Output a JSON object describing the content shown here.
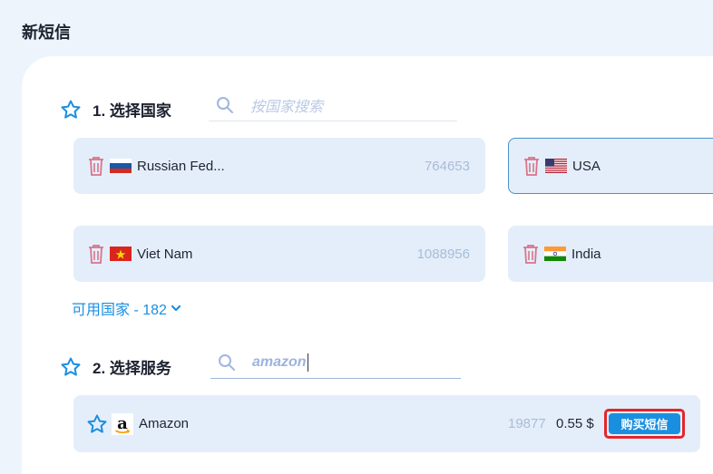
{
  "page": {
    "title": "新短信"
  },
  "country_section": {
    "title": "1. 选择国家",
    "search_placeholder": "按国家搜索",
    "countries": [
      {
        "name": "Russian Fed...",
        "count": "764653",
        "flag": "russia-flag",
        "selected": false
      },
      {
        "name": "USA",
        "count": "",
        "flag": "usa-flag",
        "selected": true
      },
      {
        "name": "Viet Nam",
        "count": "1088956",
        "flag": "vietnam-flag",
        "selected": false
      },
      {
        "name": "India",
        "count": "",
        "flag": "india-flag",
        "selected": false
      }
    ],
    "more_link": "可用国家 - 182"
  },
  "service_section": {
    "title": "2. 选择服务",
    "search_value": "amazon",
    "services": [
      {
        "name": "Amazon",
        "count": "19877",
        "price": "0.55 $",
        "buy_label": "购买短信",
        "icon": "amazon-logo-icon"
      }
    ]
  },
  "colors": {
    "accent": "#1a8fe0",
    "card_bg": "#e4eefa",
    "highlight_outline": "#e3262b",
    "trash": "#d9748a"
  }
}
